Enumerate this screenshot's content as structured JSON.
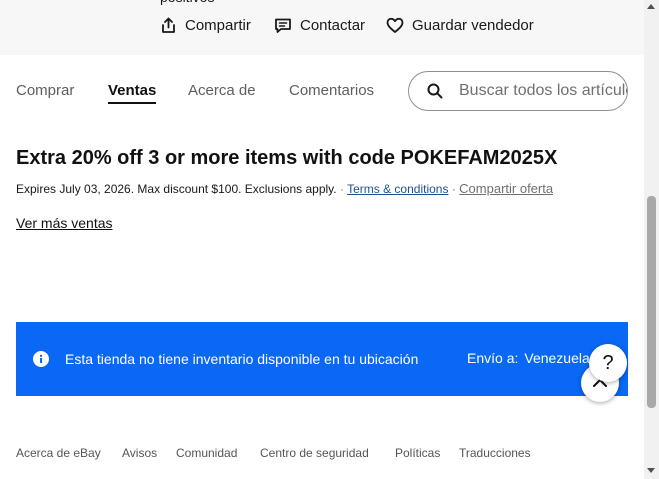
{
  "header": {
    "cut_text": "positivos",
    "actions": {
      "share": "Compartir",
      "contact": "Contactar",
      "save_seller": "Guardar vendedor"
    }
  },
  "tabs": {
    "buy": "Comprar",
    "sales": "Ventas",
    "about": "Acerca de",
    "feedback": "Comentarios",
    "active": "Ventas"
  },
  "search": {
    "placeholder": "Buscar todos los artículos",
    "icon": "search-icon"
  },
  "promo": {
    "title": "Extra 20% off 3 or more items with code POKEFAM2025X",
    "details": "Expires July 03, 2026. Max discount $100. Exclusions apply.",
    "separator": "·",
    "terms_link": "Terms & conditions",
    "share_link": "Compartir oferta",
    "more_link": "Ver más ventas"
  },
  "banner": {
    "message": "Esta tienda no tiene inventario disponible en tu ubicación",
    "ship_label": "Envío a:",
    "ship_country": "Venezuela",
    "background": "#0968f6",
    "icon": "info-icon"
  },
  "floating": {
    "help_label": "?",
    "help_icon": "help-icon",
    "top_icon": "chevron-up-icon"
  },
  "footer": {
    "links": [
      "Acerca de eBay",
      "Avisos",
      "Comunidad",
      "Centro de seguridad",
      "Políticas",
      "Traducciones"
    ]
  },
  "colors": {
    "accent": "#0968f6",
    "link": "#1f4f8f",
    "top_band": "#f7f7f7"
  }
}
